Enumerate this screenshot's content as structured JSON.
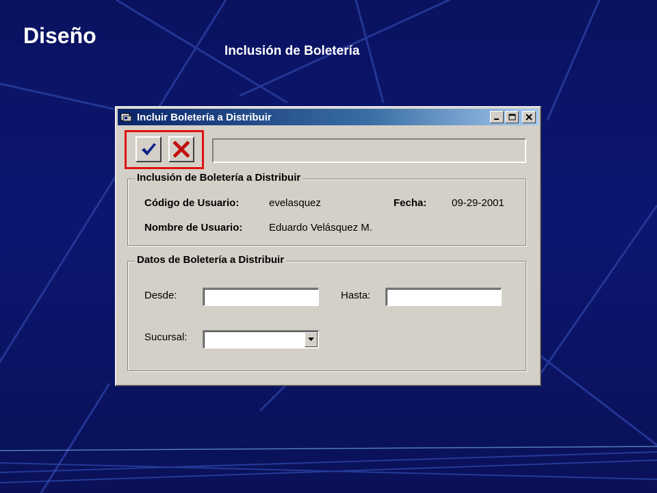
{
  "slide": {
    "title": "Diseño",
    "subtitle": "Inclusión de Boletería"
  },
  "window": {
    "title": "Incluir Boletería a Distribuir",
    "controls": [
      "minimize-icon",
      "maximize-icon",
      "close-icon"
    ]
  },
  "toolbar": {
    "accept_icon": "checkmark-icon",
    "cancel_icon": "x-icon",
    "highlight_color": "#e01010",
    "status_text": ""
  },
  "inclusion_frame": {
    "legend": "Inclusión de Boletería a Distribuir",
    "user_code_label": "Código de Usuario:",
    "user_code_value": "evelasquez",
    "date_label": "Fecha:",
    "date_value": "09-29-2001",
    "user_name_label": "Nombre de Usuario:",
    "user_name_value": "Eduardo Velásquez M."
  },
  "data_frame": {
    "legend": "Datos de Boletería a Distribuir",
    "from_label": "Desde:",
    "from_value": "",
    "to_label": "Hasta:",
    "to_value": "",
    "branch_label": "Sucursal:",
    "branch_value": ""
  },
  "colors": {
    "background": "#0c1670",
    "titlebar_start": "#0a246a",
    "titlebar_end": "#a6caf0",
    "window_face": "#d4d0c8"
  }
}
